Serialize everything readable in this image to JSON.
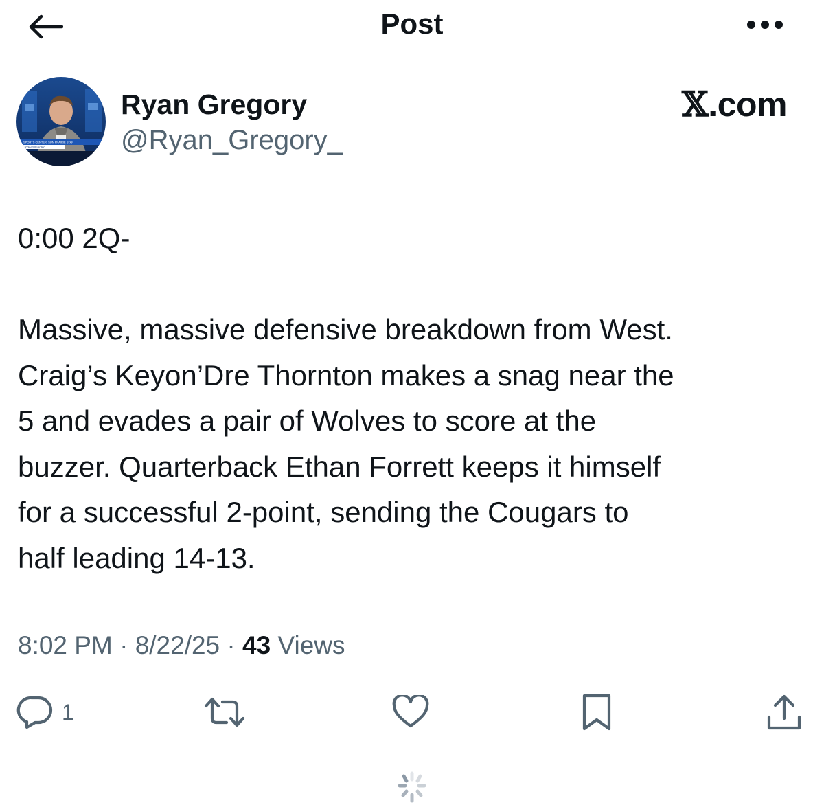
{
  "header": {
    "title": "Post",
    "back_icon": "arrow-left-icon",
    "more_icon": "more-horizontal-icon"
  },
  "author": {
    "display_name": "Ryan Gregory",
    "handle": "@Ryan_Gregory_",
    "avatar_icon": "profile-photo",
    "avatar_caption_line1": "SPORTS CENTER, SUN PRAIRIE STAR",
    "avatar_caption_line2": "RYAN GREGORY"
  },
  "brand": {
    "x_mark": "𝕏",
    "suffix": ".com"
  },
  "post": {
    "lines": [
      "0:00 2Q-",
      "",
      "Massive, massive defensive breakdown from West.",
      "Craig’s Keyon’Dre Thornton makes a snag near the",
      "5 and evades a pair of Wolves to score at the",
      "buzzer. Quarterback Ethan Forrett keeps it himself",
      "for a successful 2-point, sending the Cougars to",
      "half leading 14-13."
    ]
  },
  "meta": {
    "time": "8:02 PM",
    "separator": " · ",
    "date": "8/22/25",
    "views_count": "43",
    "views_label": " Views"
  },
  "actions": {
    "reply_count": "1",
    "reply_icon": "reply-icon",
    "repost_icon": "repost-icon",
    "like_icon": "heart-icon",
    "bookmark_icon": "bookmark-icon",
    "share_icon": "share-icon"
  },
  "colors": {
    "text_primary": "#0f1419",
    "text_secondary": "#536471",
    "icon": "#536471",
    "background": "#ffffff"
  }
}
